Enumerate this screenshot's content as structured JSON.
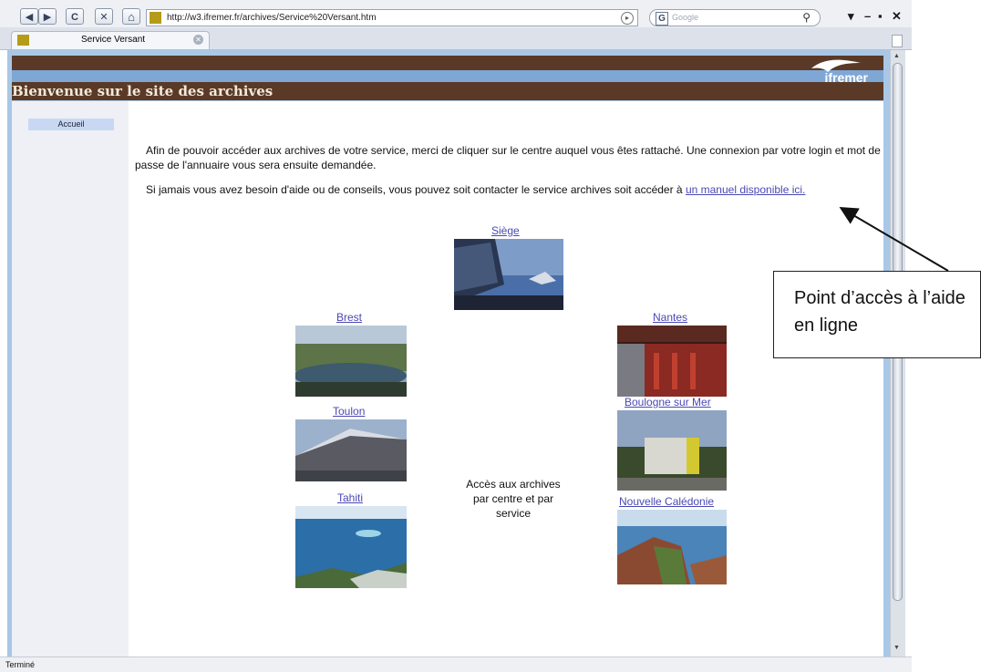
{
  "browser": {
    "back_glyph": "◀",
    "forward_glyph": "▶",
    "reload_glyph": "C",
    "stop_glyph": "✕",
    "home_glyph": "⌂",
    "url": "http://w3.ifremer.fr/archives/Service%20Versant.htm",
    "search_engine": "G",
    "search_placeholder": "Google",
    "tab_title": "Service Versant",
    "window_controls": [
      "▾",
      "–",
      "▪",
      "✕"
    ],
    "status": "Terminé"
  },
  "page": {
    "banner_title": "Bienvenue sur le site des archives",
    "logo_text": "ifremer",
    "sidebar": {
      "items": [
        {
          "label": "Accueil"
        }
      ]
    },
    "intro_text": "Afin de pouvoir accéder aux archives de votre service, merci de cliquer sur le centre auquel vous êtes rattaché. Une connexion par votre login et mot de passe de l'annuaire vous sera ensuite demandée.",
    "help_text": "Si jamais vous avez besoin d'aide ou de conseils, vous pouvez soit contacter le service archives soit accéder à",
    "help_link": "un manuel disponible ici.",
    "centres": {
      "siege": "Siège",
      "brest": "Brest",
      "nantes": "Nantes",
      "toulon": "Toulon",
      "boulogne": "Boulogne sur Mer",
      "tahiti": "Tahiti",
      "nouvelle_caledonie": "Nouvelle Calédonie"
    },
    "middle_text": "Accès aux archives par centre et par service"
  },
  "annotation": {
    "text": "Point d’accès à l’aide en ligne"
  },
  "colors": {
    "banner_brown": "#5a3a26",
    "banner_blue": "#7fa7d6",
    "link": "#4a48b4",
    "sidebar": "#eef0f5"
  }
}
